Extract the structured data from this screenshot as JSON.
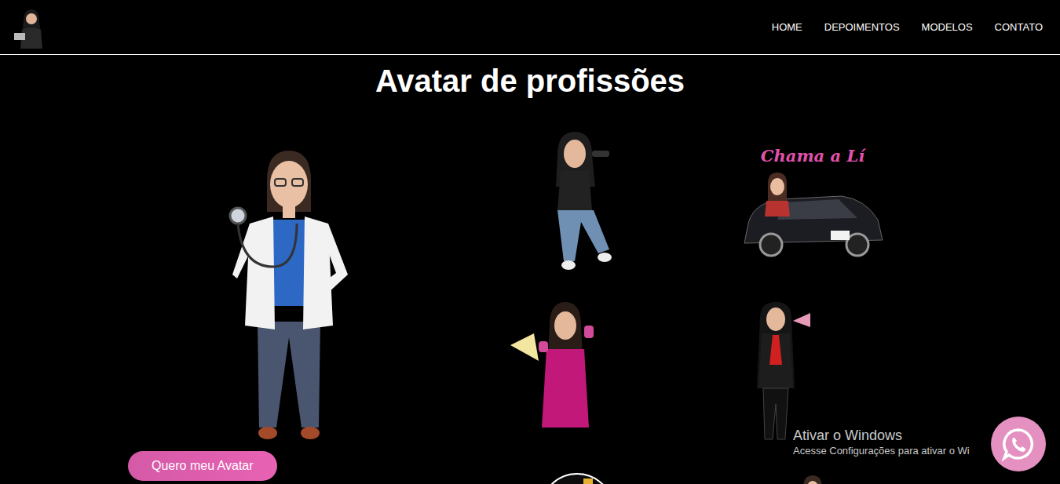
{
  "nav": [
    {
      "label": "HOME"
    },
    {
      "label": "DEPOIMENTOS"
    },
    {
      "label": "MODELOS"
    },
    {
      "label": "CONTATO"
    }
  ],
  "title": "Avatar de profissões",
  "cta": "Quero meu Avatar",
  "caption": "Chama a Lí",
  "watermark": {
    "title": "Ativar o Windows",
    "subtitle": "Acesse Configurações para ativar o Wi"
  }
}
